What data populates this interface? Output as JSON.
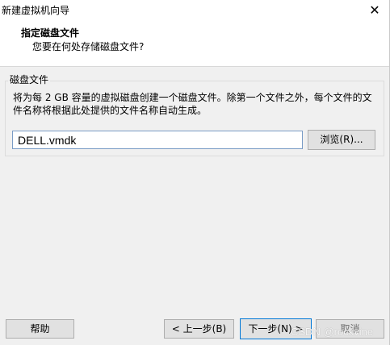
{
  "window": {
    "title": "新建虚拟机向导",
    "close_icon": "close-icon",
    "close_symbol": "✕"
  },
  "header": {
    "title": "指定磁盘文件",
    "subtitle": "您要在何处存储磁盘文件?"
  },
  "disk_file": {
    "group_label": "磁盘文件",
    "description": "将为每 2 GB 容量的虚拟磁盘创建一个磁盘文件。除第一个文件之外，每个文件的文件名称将根据此处提供的文件名称自动生成。",
    "file_name": "DELL.vmdk",
    "browse_label": "浏览(R)..."
  },
  "footer": {
    "help_label": "帮助",
    "back_label": "< 上一步(B)",
    "next_label": "下一步(N) >",
    "cancel_label": "取消"
  },
  "watermark": {
    "text": "CSDN @rockvine"
  },
  "colors": {
    "window_background": "#f0f0f0",
    "header_background": "#ffffff",
    "button_background": "#e1e1e1",
    "focus_border": "#0078d7"
  }
}
